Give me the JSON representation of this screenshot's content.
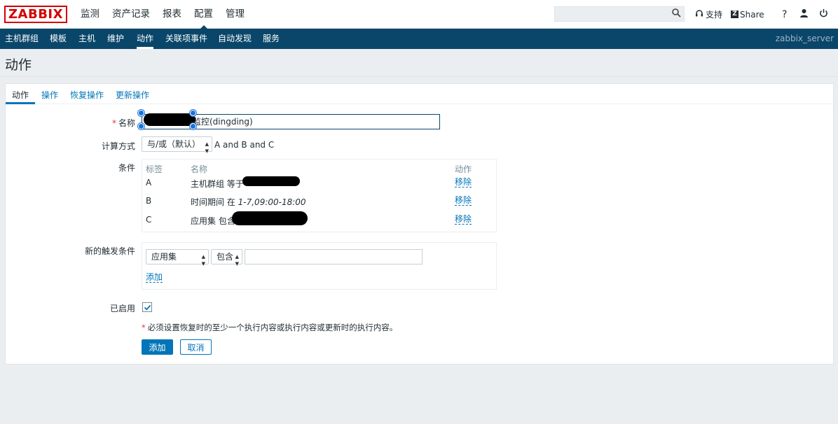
{
  "header": {
    "logo": "ZABBIX",
    "menu": [
      {
        "label": "监测",
        "active": false
      },
      {
        "label": "资产记录",
        "active": false
      },
      {
        "label": "报表",
        "active": false
      },
      {
        "label": "配置",
        "active": true
      },
      {
        "label": "管理",
        "active": false
      }
    ],
    "search": {
      "value": "",
      "placeholder": "",
      "icon": "search-icon"
    },
    "support_label": "支持",
    "share_label": "Share",
    "help_icon": "?",
    "user_icon": "user-icon",
    "logout_icon": "power-icon"
  },
  "subnav": {
    "items": [
      {
        "label": "主机群组",
        "active": false
      },
      {
        "label": "模板",
        "active": false
      },
      {
        "label": "主机",
        "active": false
      },
      {
        "label": "维护",
        "active": false
      },
      {
        "label": "动作",
        "active": true
      },
      {
        "label": "关联项事件",
        "active": false
      },
      {
        "label": "自动发现",
        "active": false
      },
      {
        "label": "服务",
        "active": false
      }
    ],
    "server": "zabbix_server"
  },
  "page": {
    "title": "动作"
  },
  "tabs": [
    {
      "label": "动作",
      "active": true
    },
    {
      "label": "操作",
      "active": false
    },
    {
      "label": "恢复操作",
      "active": false
    },
    {
      "label": "更新操作",
      "active": false
    }
  ],
  "form": {
    "name_label": "名称",
    "name_value": "监控(dingding)",
    "calc_label": "计算方式",
    "calc_select": "与/或（默认）",
    "calc_expression": "A and B and C",
    "conditions_label": "条件",
    "conditions_headers": {
      "label": "标签",
      "name": "名称",
      "action": "动作"
    },
    "conditions": [
      {
        "label": "A",
        "name": "主机群组 等于 ",
        "action": "移除"
      },
      {
        "label": "B",
        "name": "时间期间 在 ",
        "name_value": "1-7,09:00-18:00",
        "action": "移除"
      },
      {
        "label": "C",
        "name": "应用集 包含 ",
        "action": "移除"
      }
    ],
    "new_condition_label": "新的触发条件",
    "new_condition_type": "应用集",
    "new_condition_operator": "包含",
    "new_condition_value": "",
    "add_link": "添加",
    "enabled_label": "已启用",
    "enabled": true,
    "note": "必须设置恢复时的至少一个执行内容或执行内容或更新时的执行内容。",
    "add_button": "添加",
    "cancel_button": "取消"
  },
  "colors": {
    "accent": "#0275b8",
    "nav": "#0a466a",
    "brand_red": "#d40000",
    "required": "#e33734"
  }
}
